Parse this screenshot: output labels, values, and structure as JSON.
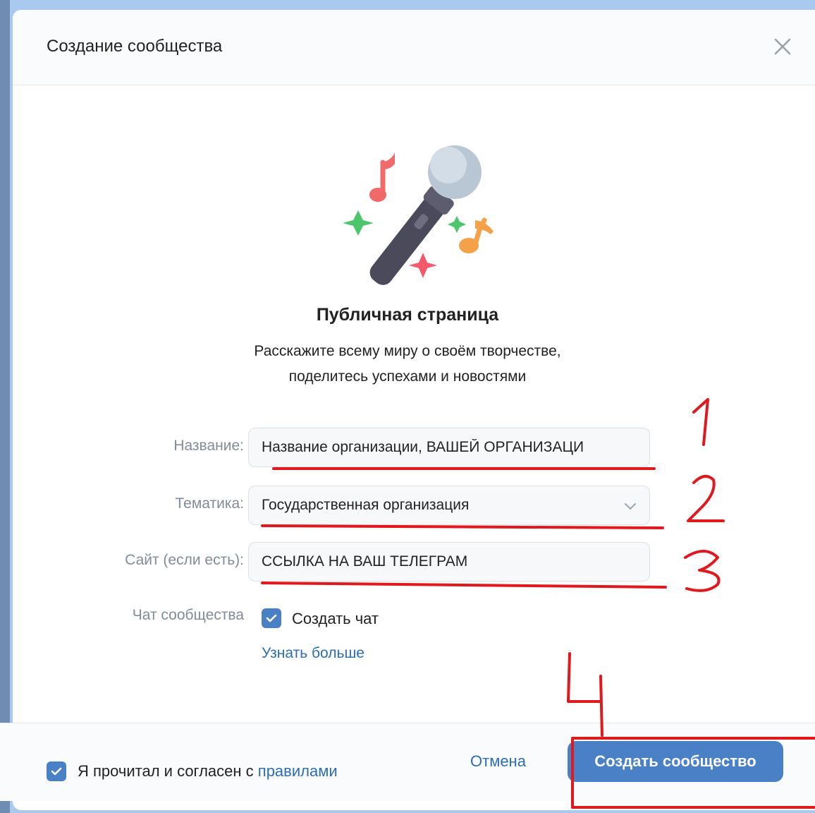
{
  "modal": {
    "title": "Создание сообщества"
  },
  "intro": {
    "title": "Публичная страница",
    "description_line1": "Расскажите всему миру о своём творчестве,",
    "description_line2": "поделитесь успехами и новостями"
  },
  "form": {
    "name": {
      "label": "Название:",
      "value": "Название организации, ВАШЕЙ ОРГАНИЗАЦИ"
    },
    "topic": {
      "label": "Тематика:",
      "value": "Государственная организация"
    },
    "site": {
      "label": "Сайт (если есть):",
      "value": "ССЫЛКА НА ВАШ ТЕЛЕГРАМ"
    },
    "chat": {
      "label": "Чат сообщества",
      "checkbox_label": "Создать чат",
      "checked": true,
      "learn_more": "Узнать больше"
    }
  },
  "footer": {
    "agree_text": "Я прочитал и согласен с ",
    "agree_link": "правилами",
    "agree_checked": true,
    "cancel_label": "Отмена",
    "submit_label": "Создать сообщество"
  },
  "annotations": {
    "step1": "1",
    "step2": "2",
    "step3": "3",
    "step4": "4"
  },
  "colors": {
    "accent": "#4a80c6",
    "link": "#2d6db3",
    "annotation": "#e0191e"
  }
}
